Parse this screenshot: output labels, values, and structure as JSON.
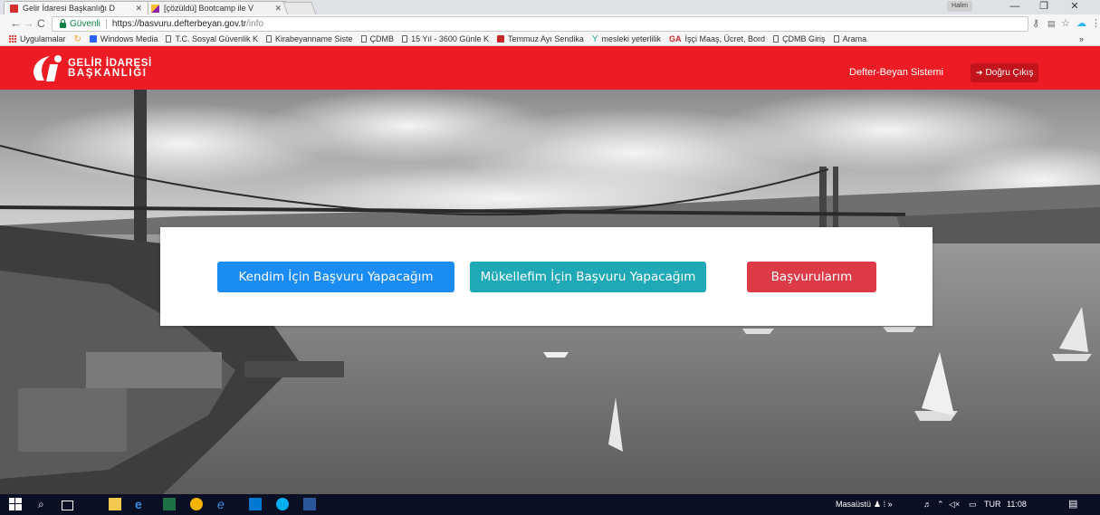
{
  "browser": {
    "tabs": [
      {
        "title": "Gelir İdaresi Başkanlığı D",
        "active": true,
        "favicon_color": "#d32f2f"
      },
      {
        "title": "[çözüldü] Bootcamp ile V",
        "active": false,
        "favicon_color": "#9c27b0"
      }
    ],
    "user_chip": "Halim",
    "window_controls": {
      "minimize": "—",
      "restore": "❐",
      "close": "✕"
    },
    "address": {
      "secure_label": "Güvenli",
      "url_host": "https://basvuru.defterbeyan.gov.tr",
      "url_path": "/info"
    },
    "bookmarks": [
      {
        "label": "Uygulamalar",
        "icon": "apps-icon"
      },
      {
        "label": "",
        "icon": "refresh-colored-icon",
        "color": "#f5a623"
      },
      {
        "label": "Windows Media",
        "icon": "windows-media-icon",
        "color": "#2962ff"
      },
      {
        "label": "T.C. Sosyal Güvenlik K",
        "icon": "page-icon"
      },
      {
        "label": "Kirabeyanname Siste",
        "icon": "page-icon"
      },
      {
        "label": "ÇDMB",
        "icon": "page-icon"
      },
      {
        "label": "15 Yıl - 3600 Günle K",
        "icon": "page-icon"
      },
      {
        "label": "Temmuz Ayı Sendika",
        "icon": "mail-icon",
        "color": "#c62828"
      },
      {
        "label": "mesleki yeterlilik",
        "icon": "myk-icon",
        "color": "#26a69a"
      },
      {
        "label": "İşçi Maaş, Ücret, Bord",
        "icon": "ga-icon",
        "color": "#c62828"
      },
      {
        "label": "ÇDMB Giriş",
        "icon": "page-icon"
      },
      {
        "label": "Arama",
        "icon": "page-icon"
      }
    ],
    "bookmarks_more": "»"
  },
  "header": {
    "logo_line1": "GELİR İDARESİ",
    "logo_line2": "BAŞKANLIĞI",
    "nav_title": "Defter-Beyan Sistemi",
    "logout_label": "Doğru Çıkış"
  },
  "main": {
    "buttons": {
      "self": "Kendim İçin Başvuru Yapacağım",
      "client": "Mükellefim İçin Başvuru Yapacağım",
      "applications": "Başvurularım"
    }
  },
  "taskbar": {
    "desktop_label": "Masaüstü",
    "lang": "TUR",
    "time": "11:08"
  },
  "colors": {
    "brand_red": "#ed1c24",
    "btn_blue": "#1a8cf4",
    "btn_teal": "#1fa9b6",
    "btn_red": "#dc3a47"
  }
}
